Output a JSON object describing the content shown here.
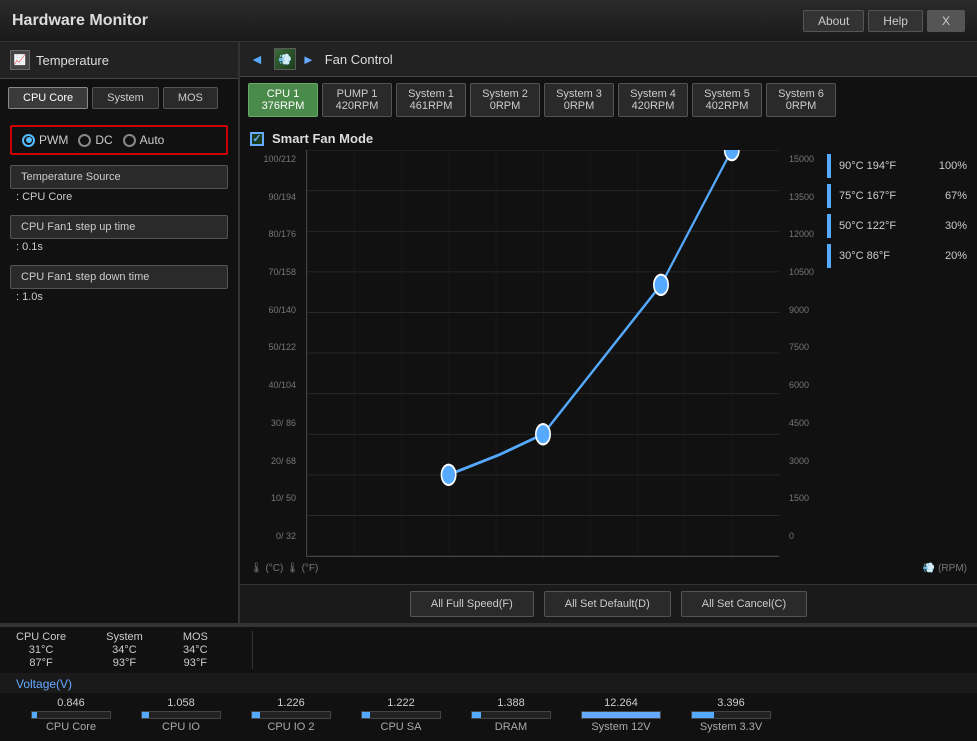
{
  "titleBar": {
    "title": "Hardware Monitor",
    "buttons": [
      "About",
      "Help",
      "X"
    ]
  },
  "tempPanel": {
    "header": "Temperature",
    "tabs": [
      "CPU Core",
      "System",
      "MOS"
    ],
    "activeTab": "CPU Core",
    "radioOptions": [
      "PWM",
      "DC",
      "Auto"
    ],
    "selectedRadio": "PWM",
    "tempSourceLabel": "Temperature Source",
    "tempSourceValue": ": CPU Core",
    "stepUpLabel": "CPU Fan1 step up time",
    "stepUpValue": ": 0.1s",
    "stepDownLabel": "CPU Fan1 step down time",
    "stepDownValue": ": 1.0s"
  },
  "fanPanel": {
    "header": "Fan Control",
    "fans": [
      {
        "name": "CPU 1",
        "rpm": "376RPM",
        "active": true
      },
      {
        "name": "PUMP 1",
        "rpm": "420RPM",
        "active": false
      },
      {
        "name": "System 1",
        "rpm": "461RPM",
        "active": false
      },
      {
        "name": "System 2",
        "rpm": "0RPM",
        "active": false
      },
      {
        "name": "System 3",
        "rpm": "0RPM",
        "active": false
      },
      {
        "name": "System 4",
        "rpm": "420RPM",
        "active": false
      },
      {
        "name": "System 5",
        "rpm": "402RPM",
        "active": false
      },
      {
        "name": "System 6",
        "rpm": "0RPM",
        "active": false
      }
    ],
    "chartTitle": "Smart Fan Mode",
    "yLeftLabels": [
      "100/212",
      "90/194",
      "80/176",
      "70/158",
      "60/140",
      "50/122",
      "40/104",
      "30/ 86",
      "20/ 68",
      "10/ 50",
      "0/  32"
    ],
    "yRightLabels": [
      "15000",
      "13500",
      "12000",
      "10500",
      "9000",
      "7500",
      "6000",
      "4500",
      "3000",
      "1500",
      "0"
    ],
    "legend": [
      {
        "temp": "90°C  194°F",
        "pct": "100%"
      },
      {
        "temp": "75°C  167°F",
        "pct": "67%"
      },
      {
        "temp": "50°C  122°F",
        "pct": "30%"
      },
      {
        "temp": "30°C   86°F",
        "pct": "20%"
      }
    ],
    "footerLeft": "🌡 (°C)  🌡 (°F)",
    "footerRight": "💨 (RPM)"
  },
  "actionButtons": [
    "All Full Speed(F)",
    "All Set Default(D)",
    "All Set Cancel(C)"
  ],
  "statusBar": [
    {
      "label": "CPU Core",
      "val1": "31°C",
      "val2": "87°F"
    },
    {
      "label": "System",
      "val1": "34°C",
      "val2": "93°F"
    },
    {
      "label": "MOS",
      "val1": "34°C",
      "val2": "93°F"
    }
  ],
  "voltageLabel": "Voltage(V)",
  "voltages": [
    {
      "label": "CPU Core",
      "value": "0.846",
      "pct": 7
    },
    {
      "label": "CPU IO",
      "value": "1.058",
      "pct": 9
    },
    {
      "label": "CPU IO 2",
      "value": "1.226",
      "pct": 10
    },
    {
      "label": "CPU SA",
      "value": "1.222",
      "pct": 10
    },
    {
      "label": "DRAM",
      "value": "1.388",
      "pct": 12
    },
    {
      "label": "System 12V",
      "value": "12.264",
      "pct": 100
    },
    {
      "label": "System 3.3V",
      "value": "3.396",
      "pct": 28
    }
  ]
}
